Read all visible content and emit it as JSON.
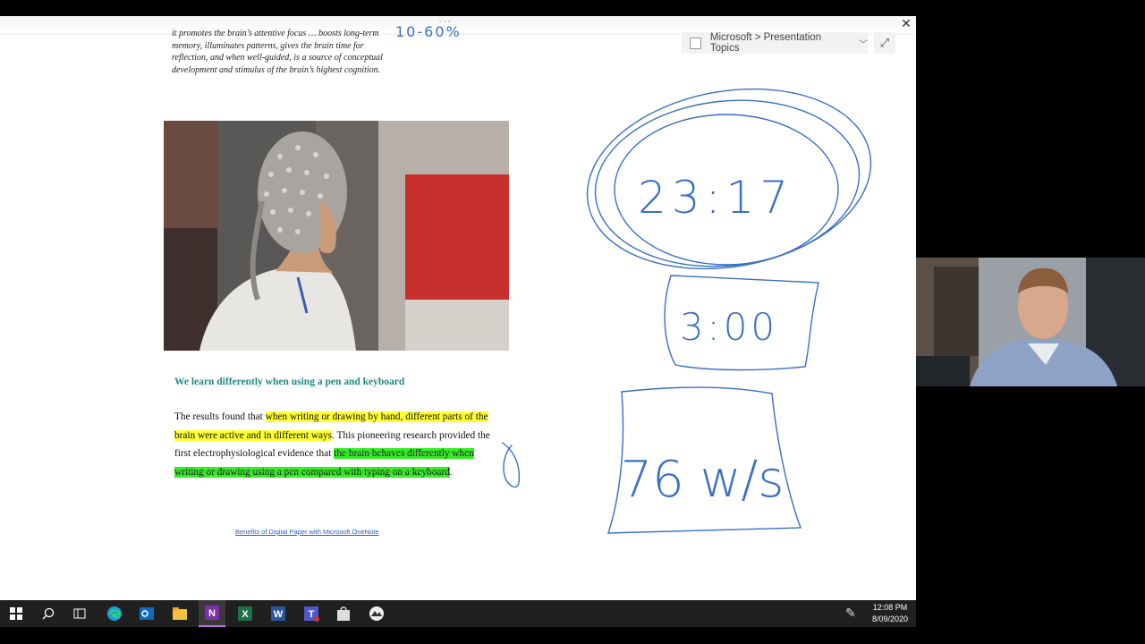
{
  "note": {
    "quote": "it promotes the brain’s attentive focus … boosts long-term memory, illuminates patterns, gives the brain time for reflection, and when well-guided, is a source of conceptual development and stimulus of the brain’s highest cognition.",
    "ink_top": "10-60%",
    "heading": "We learn differently when using a pen and keyboard",
    "para_part1": "The results found that ",
    "para_hl1": "when writing or drawing by hand, different parts of the brain were active and in different ways",
    "para_part2": ". This pioneering research provided the first electrophysiological evidence that ",
    "para_hl2": "the brain behaves differently when writing or drawing using a pen compared with typing on a keyboard",
    "para_part3": ".",
    "link": "Benefits of Digital Paper with Microsoft OneNote"
  },
  "ink": {
    "timer1": "23:17",
    "timer2": "3:00",
    "count": "76 w/s"
  },
  "breadcrumb": {
    "text": "Microsoft > Presentation Topics"
  },
  "window": {
    "more": "···",
    "close_icon": "close-icon",
    "expand_icon": "expand-icon"
  },
  "taskbar": {
    "time": "12:08 PM",
    "date": "8/09/2020",
    "icons": [
      "start-icon",
      "search-icon",
      "task-view-icon",
      "edge-icon",
      "outlook-icon",
      "file-explorer-icon",
      "onenote-icon",
      "excel-icon",
      "word-icon",
      "teams-icon",
      "store-icon",
      "app-icon"
    ]
  },
  "colors": {
    "ink": "#3a6fc4",
    "heading": "#1f8a7e",
    "highlight_yellow": "#ffff33",
    "highlight_green": "#33ee22",
    "taskbar": "#202020"
  }
}
